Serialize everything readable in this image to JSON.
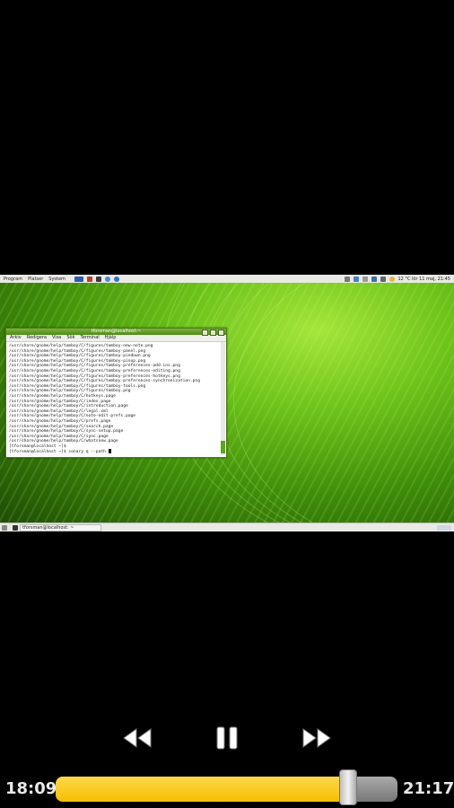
{
  "video": {
    "panel_menu": [
      "Program",
      "Platser",
      "System"
    ],
    "panel_status": "12 °C  lör 11 maj, 21:45",
    "taskbar_item": "tforsman@localhost: ~",
    "terminal": {
      "title": "tforsman@localhost:~",
      "menu": [
        "Arkiv",
        "Redigera",
        "Visa",
        "Sök",
        "Terminal",
        "Hjälp"
      ],
      "lines": [
        "/usr/share/gnome/help/tomboy/C/figures/tomboy-new-note.png",
        "/usr/share/gnome/help/tomboy/C/figures/tomboy-panel.png",
        "/usr/share/gnome/help/tomboy/C/figures/tomboy-pindown.png",
        "/usr/share/gnome/help/tomboy/C/figures/tomboy-pinup.png",
        "/usr/share/gnome/help/tomboy/C/figures/tomboy-preferences-add-ins.png",
        "/usr/share/gnome/help/tomboy/C/figures/tomboy-preferences-editing.png",
        "/usr/share/gnome/help/tomboy/C/figures/tomboy-preferences-hotkeys.png",
        "/usr/share/gnome/help/tomboy/C/figures/tomboy-preferences-synchronization.png",
        "/usr/share/gnome/help/tomboy/C/figures/tomboy-tools.png",
        "/usr/share/gnome/help/tomboy/C/figures/tomboy.png",
        "/usr/share/gnome/help/tomboy/C/hotkeys.page",
        "/usr/share/gnome/help/tomboy/C/index.page",
        "/usr/share/gnome/help/tomboy/C/introduction.page",
        "/usr/share/gnome/help/tomboy/C/legal.xml",
        "/usr/share/gnome/help/tomboy/C/note-edit-prefs.page",
        "/usr/share/gnome/help/tomboy/C/prefs.page",
        "/usr/share/gnome/help/tomboy/C/search.page",
        "/usr/share/gnome/help/tomboy/C/sync-setup.page",
        "/usr/share/gnome/help/tomboy/C/sync.page",
        "/usr/share/gnome/help/tomboy/C/whatsnew.page",
        "[tforsman@localhost ~]$",
        "[tforsman@localhost ~]$ conary q --path"
      ]
    }
  },
  "player": {
    "elapsed": "18:09",
    "total": "21:17",
    "progress_fraction": 0.853,
    "accent_color": "#f5bf00",
    "controls": {
      "rewind_icon": "rewind-icon",
      "pause_icon": "pause-icon",
      "forward_icon": "fast-forward-icon"
    }
  }
}
